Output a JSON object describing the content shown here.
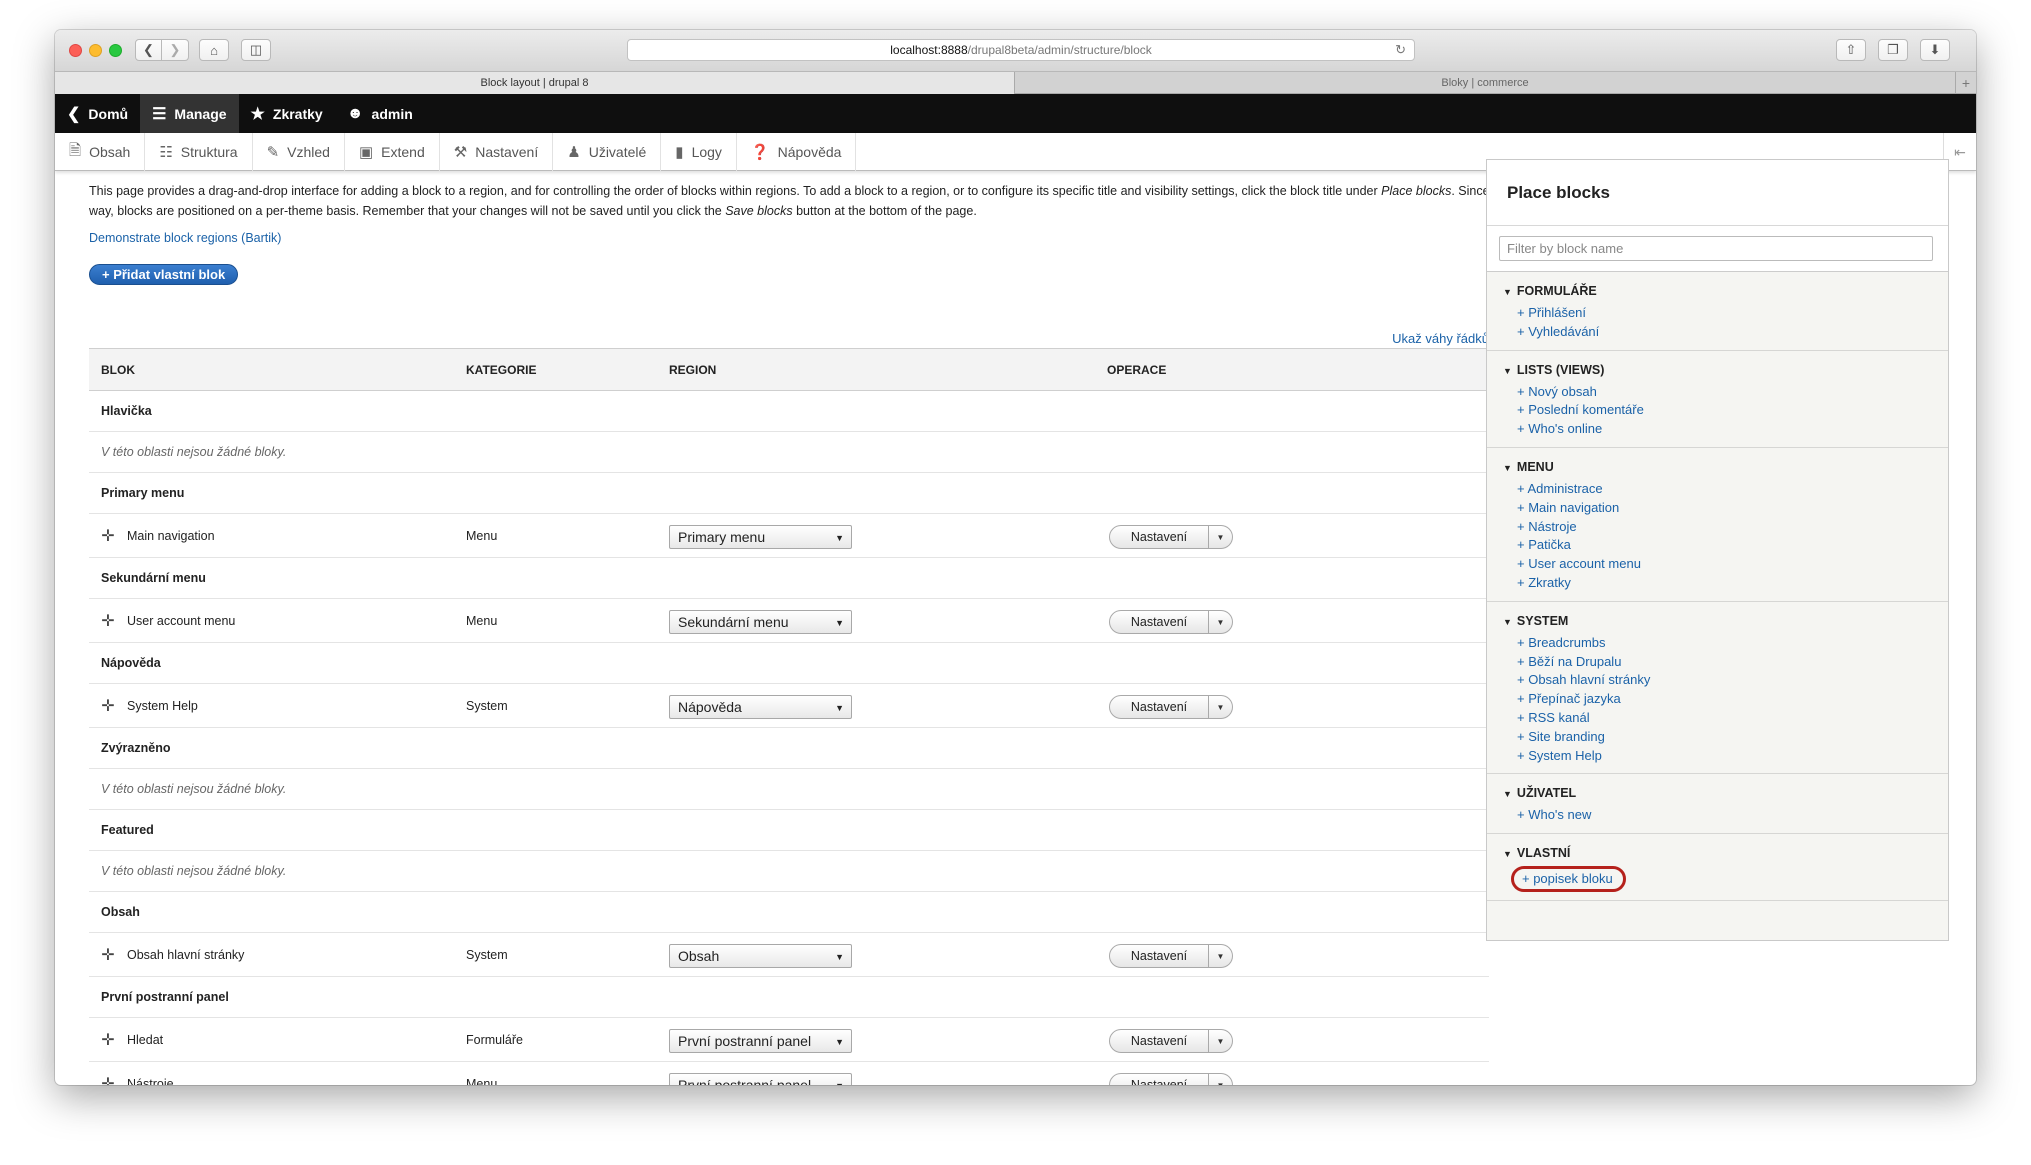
{
  "browser": {
    "url_host": "localhost:8888",
    "url_path": "/drupal8beta/admin/structure/block",
    "tabs": [
      {
        "label": "Block layout | drupal 8"
      },
      {
        "label": "Bloky | commerce"
      }
    ]
  },
  "toolbar": {
    "primary": [
      {
        "label": "Domů",
        "icon": "back-circle-icon"
      },
      {
        "label": "Manage",
        "icon": "menu-icon"
      },
      {
        "label": "Zkratky",
        "icon": "star-icon"
      },
      {
        "label": "admin",
        "icon": "user-icon"
      }
    ],
    "secondary": [
      {
        "label": "Obsah",
        "icon": "document-icon"
      },
      {
        "label": "Struktura",
        "icon": "structure-icon"
      },
      {
        "label": "Vzhled",
        "icon": "paintbrush-icon"
      },
      {
        "label": "Extend",
        "icon": "puzzle-icon"
      },
      {
        "label": "Nastavení",
        "icon": "wrench-icon"
      },
      {
        "label": "Uživatelé",
        "icon": "people-icon"
      },
      {
        "label": "Logy",
        "icon": "bar-chart-icon"
      },
      {
        "label": "Nápověda",
        "icon": "help-icon"
      }
    ]
  },
  "help": {
    "part1": "This page provides a drag-and-drop interface for adding a block to a region, and for controlling the order of blocks within regions. To add a block to a region, or to configure its specific title and visibility settings, click the block title under ",
    "em1": "Place blocks",
    "part2": ". Since not all themes implement the same regions, or display regions in the same way, blocks are positioned on a per-theme basis. Remember that your changes will not be saved until you click the ",
    "em2": "Save blocks",
    "part3": " button at the bottom of the page."
  },
  "demo_link": "Demonstrate block regions (Bartik)",
  "add_button": "+ Přidat vlastní blok",
  "weights_link": "Ukaž váhy řádků",
  "table": {
    "headers": {
      "block": "Blok",
      "category": "Kategorie",
      "region": "Region",
      "operations": "Operace"
    },
    "op_label": "Nastavení",
    "empty_msg": "V této oblasti nejsou žádné bloky.",
    "rows": [
      {
        "type": "region",
        "title": "Hlavička"
      },
      {
        "type": "empty"
      },
      {
        "type": "region",
        "title": "Primary menu"
      },
      {
        "type": "block",
        "name": "Main navigation",
        "category": "Menu",
        "region": "Primary menu"
      },
      {
        "type": "region",
        "title": "Sekundární menu"
      },
      {
        "type": "block",
        "name": "User account menu",
        "category": "Menu",
        "region": "Sekundární menu"
      },
      {
        "type": "region",
        "title": "Nápověda"
      },
      {
        "type": "block",
        "name": "System Help",
        "category": "System",
        "region": "Nápověda"
      },
      {
        "type": "region",
        "title": "Zvýrazněno"
      },
      {
        "type": "empty"
      },
      {
        "type": "region",
        "title": "Featured"
      },
      {
        "type": "empty"
      },
      {
        "type": "region",
        "title": "Obsah"
      },
      {
        "type": "block",
        "name": "Obsah hlavní stránky",
        "category": "System",
        "region": "Obsah"
      },
      {
        "type": "region",
        "title": "První postranní panel"
      },
      {
        "type": "block",
        "name": "Hledat",
        "category": "Formuláře",
        "region": "První postranní panel"
      },
      {
        "type": "block",
        "name": "Nástroje",
        "category": "Menu",
        "region": "První postranní panel"
      }
    ]
  },
  "sidebar": {
    "title": "Place blocks",
    "filter_placeholder": "Filter by block name",
    "categories": [
      {
        "title": "Formuláře",
        "items": [
          "+ Přihlášení",
          "+ Vyhledávání"
        ]
      },
      {
        "title": "Lists (Views)",
        "items": [
          "+ Nový obsah",
          "+ Poslední komentáře",
          "+ Who's online"
        ]
      },
      {
        "title": "Menu",
        "items": [
          "+ Administrace",
          "+ Main navigation",
          "+ Nástroje",
          "+ Patička",
          "+ User account menu",
          "+ Zkratky"
        ]
      },
      {
        "title": "System",
        "items": [
          "+ Breadcrumbs",
          "+ Běží na Drupalu",
          "+ Obsah hlavní stránky",
          "+ Přepínač jazyka",
          "+ RSS kanál",
          "+ Site branding",
          "+ System Help"
        ]
      },
      {
        "title": "Uživatel",
        "items": [
          "+ Who's new"
        ]
      },
      {
        "title": "Vlastní",
        "items": [
          "+ popisek bloku"
        ],
        "highlight_last": true
      }
    ]
  },
  "colors": {
    "link": "#1b62a8",
    "button": "#2a6fc2",
    "highlight": "#b5211c"
  }
}
